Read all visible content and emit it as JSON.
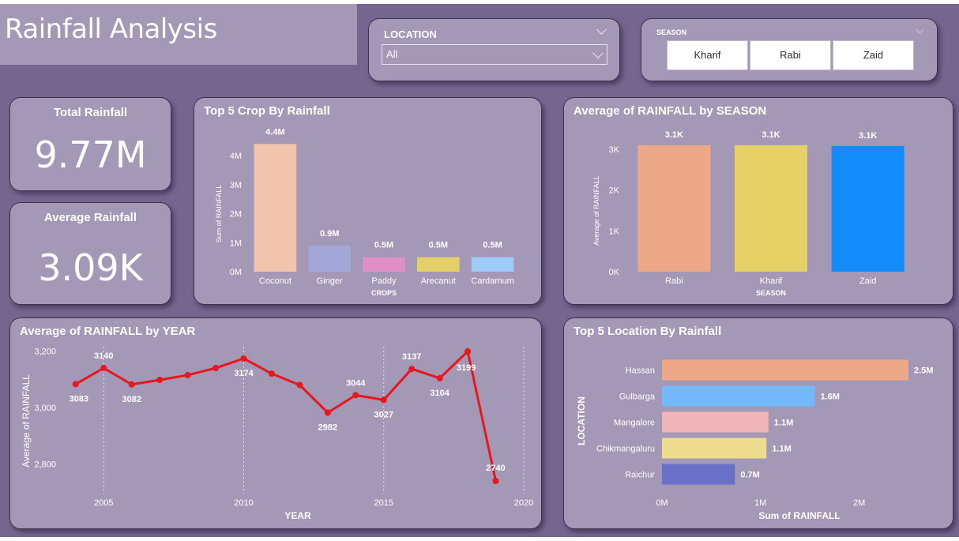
{
  "page": {
    "title": "Rainfall Analysis"
  },
  "slicers": {
    "location": {
      "label": "LOCATION",
      "value": "All"
    },
    "season": {
      "label": "SEASON",
      "options": [
        "Kharif",
        "Rabi",
        "Zaid"
      ]
    }
  },
  "kpis": {
    "total": {
      "label": "Total Rainfall",
      "value": "9.77M"
    },
    "average": {
      "label": "Average Rainfall",
      "value": "3.09K"
    }
  },
  "chart_data": [
    {
      "id": "crop",
      "type": "bar",
      "title": "Top 5 Crop By Rainfall",
      "xlabel": "CROPS",
      "ylabel": "Sum of RAINFALL",
      "categories": [
        "Coconut",
        "Ginger",
        "Paddy",
        "Arecanut",
        "Cardamum"
      ],
      "values": [
        4400000,
        900000,
        500000,
        500000,
        500000
      ],
      "data_labels": [
        "4.4M",
        "0.9M",
        "0.5M",
        "0.5M",
        "0.5M"
      ],
      "colors": [
        "#f2c4ad",
        "#a3a6d8",
        "#e38fc7",
        "#e5cf68",
        "#9ecbf7"
      ],
      "ylim": [
        0,
        4000000
      ],
      "yticks": [
        0,
        1000000,
        2000000,
        3000000,
        4000000
      ],
      "ytick_labels": [
        "0M",
        "1M",
        "2M",
        "3M",
        "4M"
      ]
    },
    {
      "id": "season",
      "type": "bar",
      "title": "Average of RAINFALL by SEASON",
      "xlabel": "SEASON",
      "ylabel": "Average of RAINFALL",
      "categories": [
        "Rabi",
        "Kharif",
        "Zaid"
      ],
      "values": [
        3100,
        3100,
        3080
      ],
      "data_labels": [
        "3.1K",
        "3.1K",
        "3.1K"
      ],
      "colors": [
        "#eda887",
        "#e5d165",
        "#138cfb"
      ],
      "ylim": [
        0,
        3000
      ],
      "yticks": [
        0,
        1000,
        2000,
        3000
      ],
      "ytick_labels": [
        "0K",
        "1K",
        "2K",
        "3K"
      ]
    },
    {
      "id": "year",
      "type": "line",
      "title": "Average of RAINFALL by YEAR",
      "xlabel": "YEAR",
      "ylabel": "Average of RAINFALL",
      "color": "#e8161d",
      "x": [
        2004,
        2005,
        2006,
        2007,
        2008,
        2009,
        2010,
        2011,
        2012,
        2013,
        2014,
        2015,
        2016,
        2017,
        2018,
        2019
      ],
      "y": [
        3083,
        3140,
        3082,
        3098,
        3115,
        3140,
        3174,
        3120,
        3080,
        2982,
        3044,
        3027,
        3137,
        3104,
        3199,
        2740
      ],
      "point_labels": [
        "3083",
        "3140",
        "3082",
        "",
        "",
        "",
        "3174",
        "",
        "",
        "2982",
        "3044",
        "3027",
        "3137",
        "3104",
        "3199",
        "2740"
      ],
      "xlim": [
        2003.3,
        2020
      ],
      "ylim": [
        2740,
        3210
      ],
      "xticks": [
        2005,
        2010,
        2015,
        2020
      ],
      "xtick_labels": [
        "2005",
        "2010",
        "2015",
        "2020"
      ],
      "yticks": [
        2800,
        3000,
        3200
      ],
      "ytick_labels": [
        "2,800",
        "3,000",
        "3,200"
      ]
    },
    {
      "id": "location",
      "type": "bar",
      "orientation": "horizontal",
      "title": "Top 5 Location By Rainfall",
      "xlabel": "Sum of RAINFALL",
      "ylabel": "LOCATION",
      "categories": [
        "Hassan",
        "Gulbarga",
        "Mangalore",
        "Chikmangaluru",
        "Raichur"
      ],
      "values": [
        2500000,
        1550000,
        1080000,
        1060000,
        740000
      ],
      "data_labels": [
        "2.5M",
        "1.6M",
        "1.1M",
        "1.1M",
        "0.7M"
      ],
      "colors": [
        "#eda887",
        "#72b8fb",
        "#f0b5b8",
        "#eedd90",
        "#6a6fc8"
      ],
      "xlim": [
        0,
        2500000
      ],
      "xticks": [
        0,
        1000000,
        2000000
      ],
      "xtick_labels": [
        "0M",
        "1M",
        "2M"
      ]
    }
  ]
}
